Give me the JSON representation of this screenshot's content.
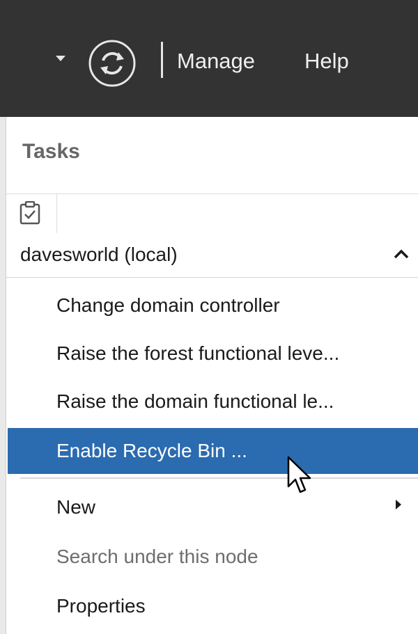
{
  "toolbar": {
    "manage_label": "Manage",
    "help_label": "Help",
    "refresh_icon": "refresh-icon",
    "dropdown_icon": "chevron-down-icon"
  },
  "tasks": {
    "title": "Tasks",
    "toolbar_icon": "clipboard-check-icon",
    "section": {
      "label": "davesworld (local)",
      "collapse_icon": "chevron-up-icon"
    },
    "items": [
      {
        "label": "Change domain controller",
        "state": "normal"
      },
      {
        "label": "Raise the forest functional leve...",
        "state": "normal"
      },
      {
        "label": "Raise the domain functional le...",
        "state": "normal"
      },
      {
        "label": "Enable Recycle Bin ...",
        "state": "selected"
      },
      {
        "label": "New",
        "state": "normal",
        "has_submenu": true
      },
      {
        "label": "Search under this node",
        "state": "disabled"
      },
      {
        "label": "Properties",
        "state": "normal"
      }
    ]
  },
  "colors": {
    "toolbar_bg": "#333333",
    "selection": "#2b6bb0",
    "disabled_text": "#6d6d6d"
  },
  "cursor": "mouse-pointer-icon"
}
